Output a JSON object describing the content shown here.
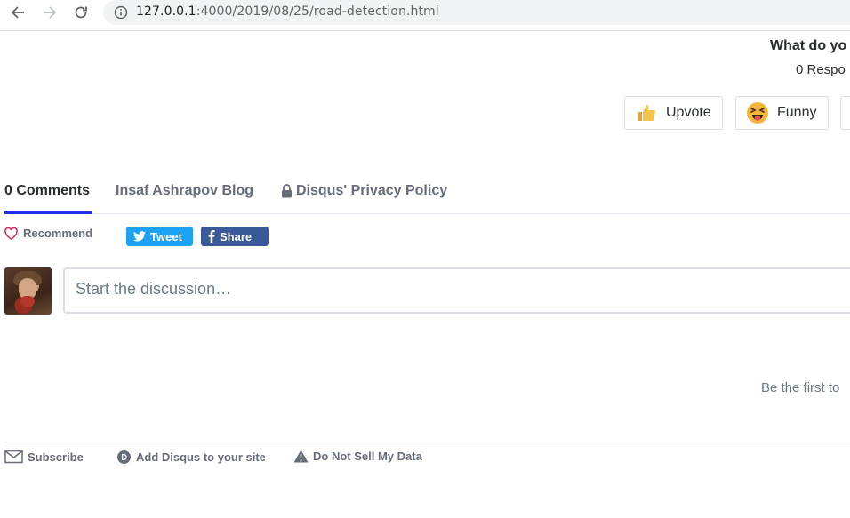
{
  "browser": {
    "url_host": "127.0.0.1",
    "url_rest": ":4000/2019/08/25/road-detection.html",
    "icons": [
      "back-arrow-icon",
      "forward-arrow-icon",
      "reload-icon",
      "info-icon"
    ]
  },
  "reactions": {
    "title": "What do yo",
    "count_text": "0 Respo",
    "buttons": [
      {
        "label": "Upvote",
        "icon": "thumbs-up-icon"
      },
      {
        "label": "Funny",
        "icon": "laughing-face-icon"
      }
    ]
  },
  "tabs": {
    "comments": "0 Comments",
    "blog": "Insaf Ashrapov Blog",
    "privacy": "Disqus' Privacy Policy"
  },
  "share": {
    "recommend": "Recommend",
    "tweet": "Tweet",
    "share": "Share"
  },
  "composer": {
    "placeholder": "Start the discussion…"
  },
  "empty_state": "Be the first to",
  "footer": {
    "subscribe": "Subscribe",
    "add_disqus": "Add Disqus to your site",
    "do_not_sell": "Do Not Sell My Data"
  },
  "colors": {
    "accent": "#1e30e6",
    "twitter": "#1da1f2",
    "facebook": "#3b5998",
    "heart": "#e0245e"
  }
}
